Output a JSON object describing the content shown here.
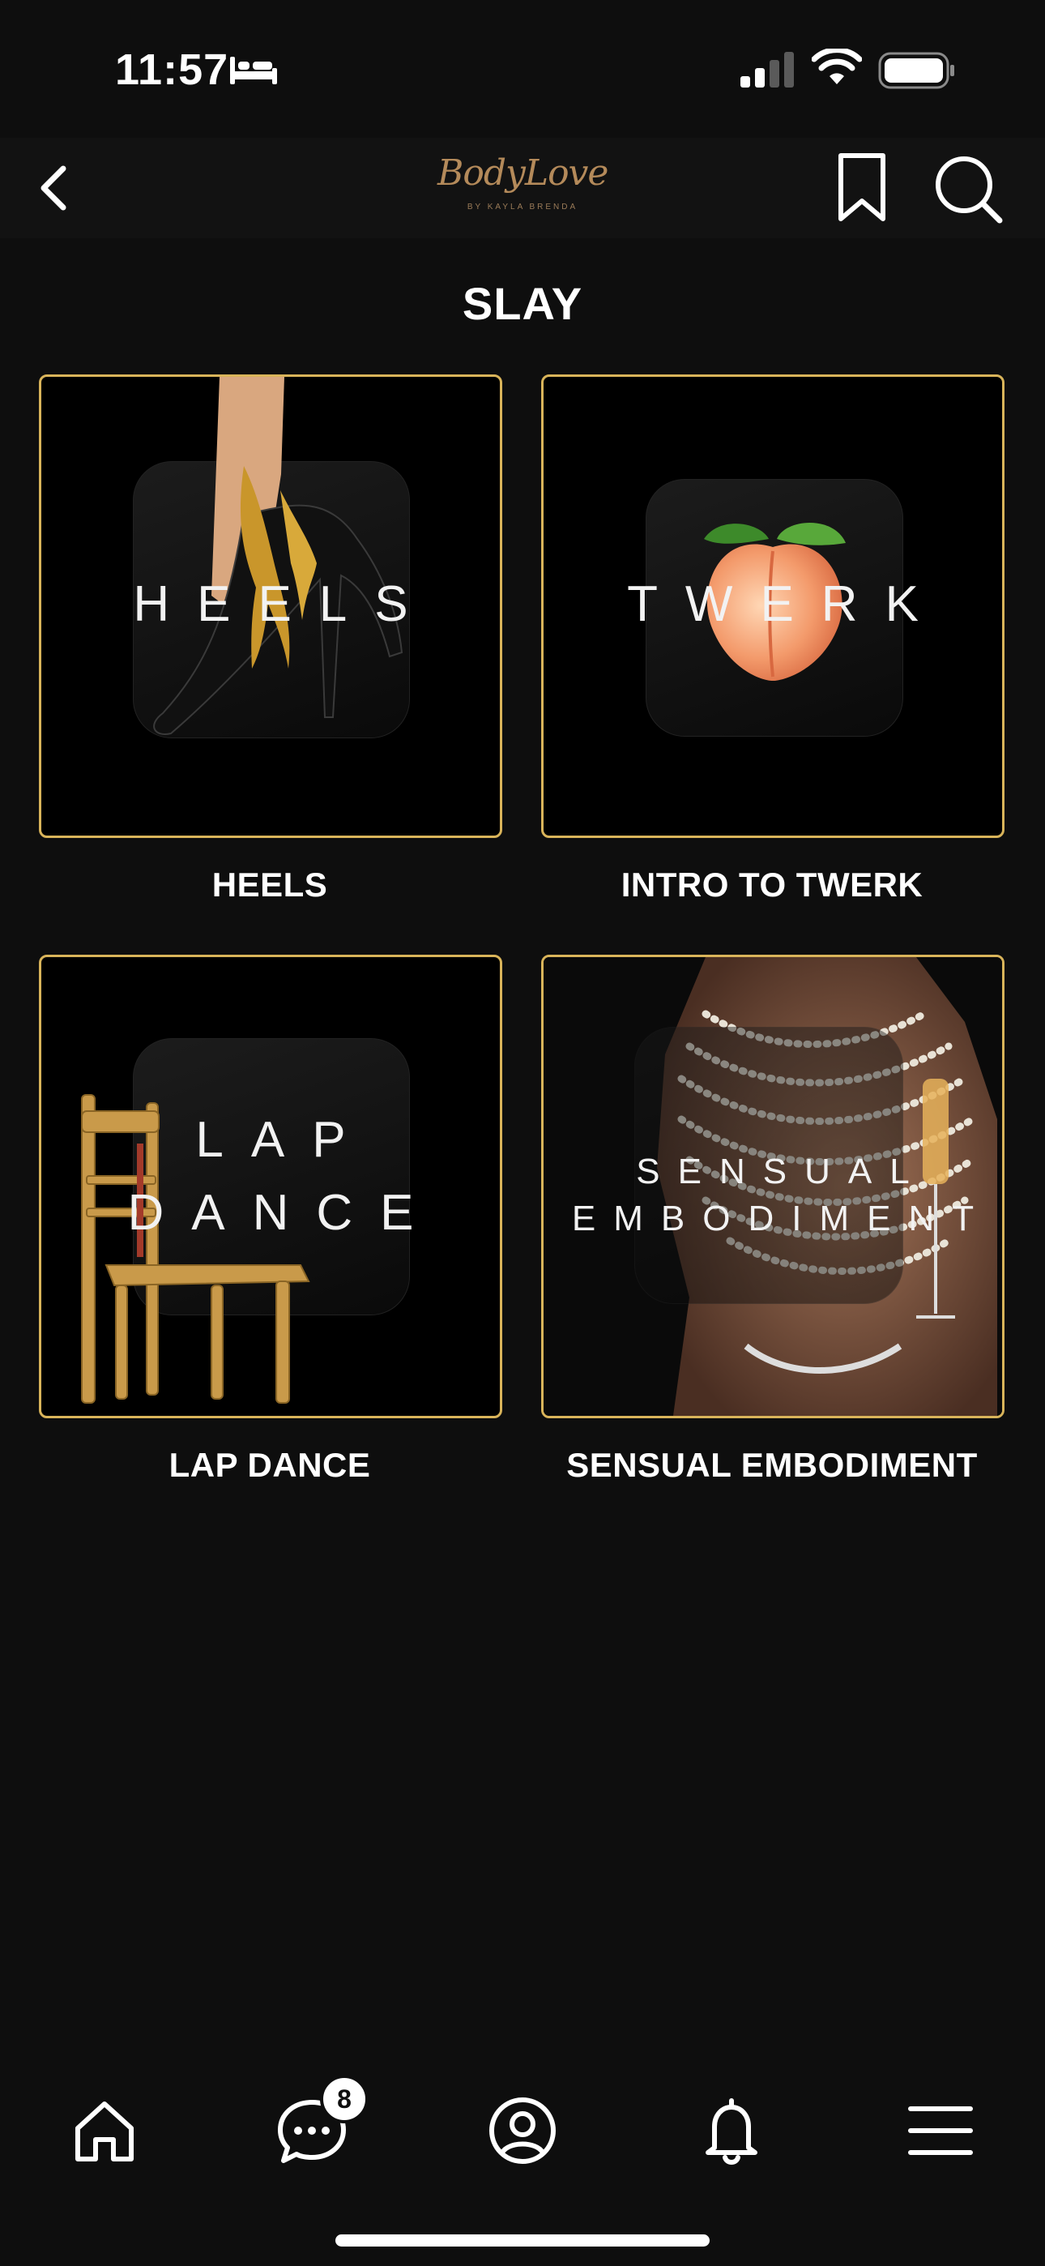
{
  "status": {
    "time": "11:57"
  },
  "header": {
    "logo_text": "BodyLove",
    "logo_subtext": "BY KAYLA BRENDA"
  },
  "page": {
    "title": "SLAY"
  },
  "cards": [
    {
      "tile_text": "HEELS",
      "label": "HEELS"
    },
    {
      "tile_text": "TWERK",
      "label": "INTRO TO TWERK"
    },
    {
      "tile_line1": "LAP",
      "tile_line2": "DANCE",
      "label": "LAP DANCE"
    },
    {
      "tile_line1": "SENSUAL",
      "tile_line2": "EMBODIMENT",
      "label": "SENSUAL EMBODIMENT"
    }
  ],
  "tabbar": {
    "chat_badge": "8"
  },
  "colors": {
    "background": "#0e0e0e",
    "card_border": "#d9b45a",
    "logo": "#b48a5a"
  },
  "icons": [
    "bed-icon",
    "signal-icon",
    "wifi-icon",
    "battery-icon",
    "back-chevron-icon",
    "bookmark-icon",
    "search-icon",
    "home-icon",
    "chat-icon",
    "profile-icon",
    "bell-icon",
    "menu-icon"
  ]
}
